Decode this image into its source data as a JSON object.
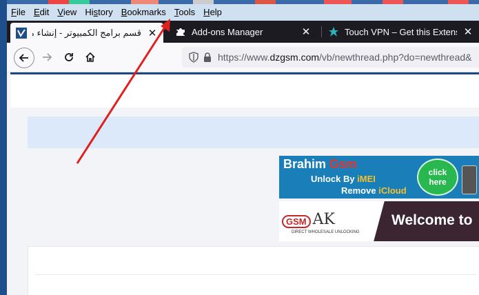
{
  "menubar": {
    "items": [
      {
        "prefix": "",
        "access": "F",
        "rest": "ile"
      },
      {
        "prefix": "",
        "access": "E",
        "rest": "dit"
      },
      {
        "prefix": "",
        "access": "V",
        "rest": "iew"
      },
      {
        "prefix": "Hi",
        "access": "s",
        "rest": "tory"
      },
      {
        "prefix": "",
        "access": "B",
        "rest": "ookmarks"
      },
      {
        "prefix": "",
        "access": "T",
        "rest": "ools"
      },
      {
        "prefix": "",
        "access": "H",
        "rest": "elp"
      }
    ]
  },
  "tabs": [
    {
      "title": "قسم برامج الكمبيوتر - إنشاء موضوع",
      "icon": "vbulletin-favicon",
      "active": true
    },
    {
      "title": "Add-ons Manager",
      "icon": "puzzle-icon",
      "active": false
    },
    {
      "title": "Touch VPN – Get this Extension",
      "icon": "touch-vpn-icon",
      "active": false
    }
  ],
  "url": {
    "scheme": "https://www.",
    "host": "dzgsm.com",
    "path": "/vb/newthread.php?do=newthread&"
  },
  "banners": {
    "brahim": {
      "word1": "Brahim",
      "word2": "Gsm",
      "line2a": "Unlock By ",
      "line2b": "iMEI",
      "line3a": "Remove ",
      "line3b": "iCloud",
      "button": "click here"
    },
    "gsmak": {
      "logo": "GSM",
      "ak": "AK",
      "tagline": "DIRECT WHOLESALE UNLOCKING",
      "welcome": "Welcome to"
    }
  },
  "colors": {
    "menubar": "#cfe0f1",
    "tabbar": "#1c1b22",
    "annotation_arrow": "#e01f1f"
  }
}
